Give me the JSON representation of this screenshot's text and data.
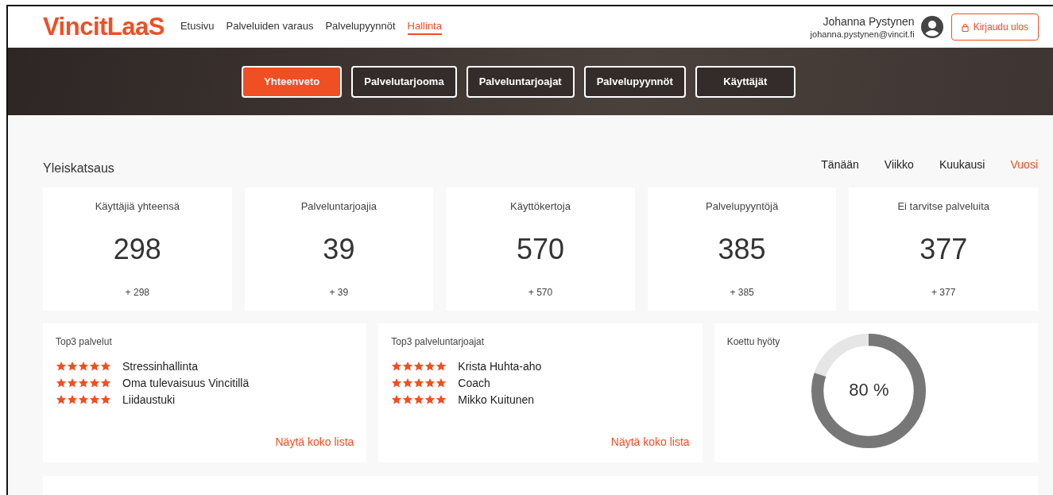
{
  "header": {
    "logo": "VincitLaaS",
    "nav": [
      {
        "label": "Etusivu",
        "selected": false
      },
      {
        "label": "Palveluiden varaus",
        "selected": false
      },
      {
        "label": "Palvelupyynnöt",
        "selected": false
      },
      {
        "label": "Hallinta",
        "selected": true
      }
    ],
    "user": {
      "name": "Johanna Pystynen",
      "email": "johanna.pystynen@vincit.fi"
    },
    "logout": "Kirjaudu ulos"
  },
  "tabs": [
    {
      "label": "Yhteenveto",
      "selected": true
    },
    {
      "label": "Palvelutarjooma",
      "selected": false
    },
    {
      "label": "Palveluntarjoajat",
      "selected": false
    },
    {
      "label": "Palvelupyynnöt",
      "selected": false
    },
    {
      "label": "Käyttäjät",
      "selected": false
    }
  ],
  "overview": {
    "title": "Yleiskatsaus",
    "periods": [
      {
        "label": "Tänään",
        "selected": false
      },
      {
        "label": "Viikko",
        "selected": false
      },
      {
        "label": "Kuukausi",
        "selected": false
      },
      {
        "label": "Vuosi",
        "selected": true
      }
    ]
  },
  "stats": [
    {
      "label": "Käyttäjiä yhteensä",
      "value": "298",
      "change": "+ 298"
    },
    {
      "label": "Palveluntarjoajia",
      "value": "39",
      "change": "+ 39"
    },
    {
      "label": "Käyttökertoja",
      "value": "570",
      "change": "+ 570"
    },
    {
      "label": "Palvelupyyntöjä",
      "value": "385",
      "change": "+ 385"
    },
    {
      "label": "Ei tarvitse palveluita",
      "value": "377",
      "change": "+ 377"
    }
  ],
  "top_lists": [
    {
      "title": "Top3 palvelut",
      "items": [
        {
          "name": "Stressinhallinta",
          "stars": 5
        },
        {
          "name": "Oma tulevaisuus Vincitillä",
          "stars": 5
        },
        {
          "name": "Liidaustuki",
          "stars": 5
        }
      ],
      "link": "Näytä koko lista"
    },
    {
      "title": "Top3 palveluntarjoajat",
      "items": [
        {
          "name": "Krista Huhta-aho",
          "stars": 5
        },
        {
          "name": "Coach",
          "stars": 5
        },
        {
          "name": "Mikko Kuitunen",
          "stars": 5
        }
      ],
      "link": "Näytä koko lista"
    }
  ],
  "benefit": {
    "title": "Koettu hyöty",
    "level": 0.8,
    "reading": "80 %"
  }
}
